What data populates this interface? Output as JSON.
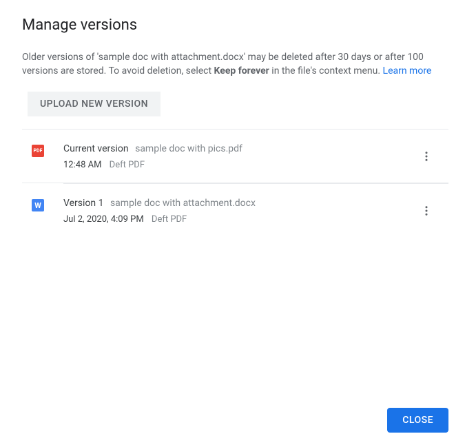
{
  "dialog": {
    "title": "Manage versions",
    "description_pre": "Older versions of 'sample doc with attachment.docx' may be deleted after 30 days or after 100 versions are stored. To avoid deletion, select ",
    "description_bold": "Keep forever",
    "description_post": " in the file's context menu. ",
    "learn_more": "Learn more"
  },
  "upload_button": "UPLOAD NEW VERSION",
  "versions": [
    {
      "icon_type": "pdf",
      "icon_label": "PDF",
      "label": "Current version",
      "filename": "sample doc with pics.pdf",
      "timestamp": "12:48 AM",
      "user": "Deft PDF"
    },
    {
      "icon_type": "word",
      "icon_label": "W",
      "label": "Version 1",
      "filename": "sample doc with attachment.docx",
      "timestamp": "Jul 2, 2020, 4:09 PM",
      "user": "Deft PDF"
    }
  ],
  "close_button": "CLOSE"
}
